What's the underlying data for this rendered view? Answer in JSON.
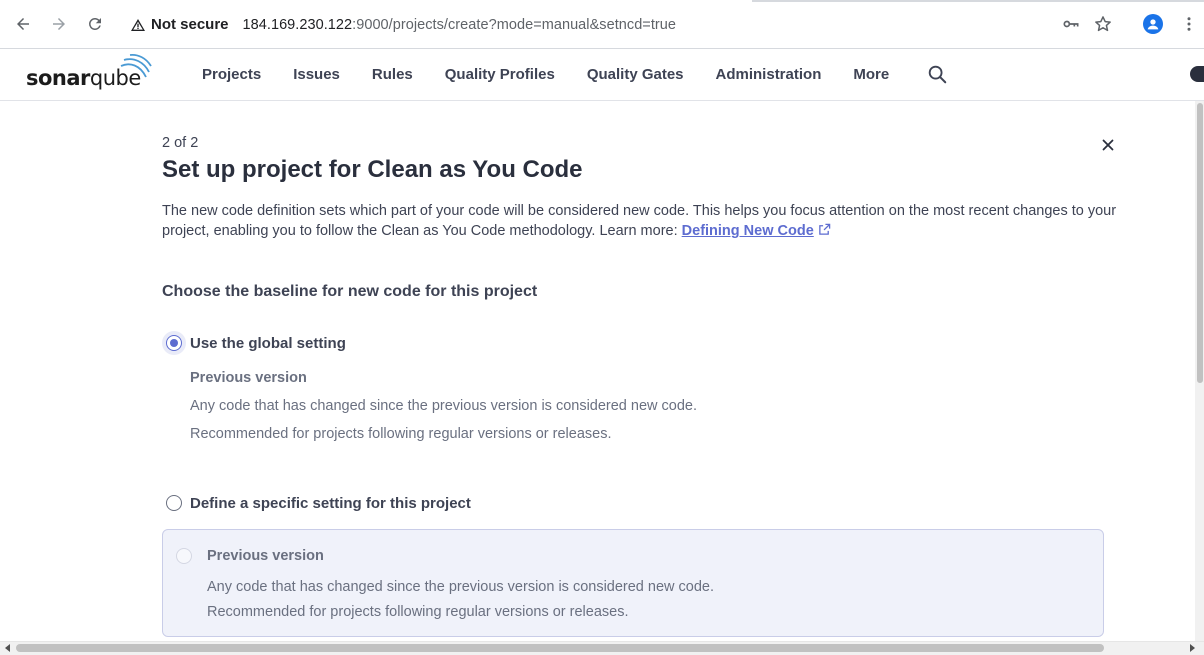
{
  "browser": {
    "security_label": "Not secure",
    "url_host": "184.169.230.122",
    "url_rest": ":9000/projects/create?mode=manual&setncd=true"
  },
  "header": {
    "logo_text_a": "sonar",
    "logo_text_b": "qube",
    "menu": [
      {
        "label": "Projects"
      },
      {
        "label": "Issues"
      },
      {
        "label": "Rules"
      },
      {
        "label": "Quality Profiles"
      },
      {
        "label": "Quality Gates"
      },
      {
        "label": "Administration"
      },
      {
        "label": "More"
      }
    ]
  },
  "page": {
    "step": "2 of 2",
    "title": "Set up project for Clean as You Code",
    "description": "The new code definition sets which part of your code will be considered new code. This helps you focus attention on the most recent changes to your project, enabling you to follow the Clean as You Code methodology. Learn more: ",
    "learn_more_link": "Defining New Code",
    "section_title": "Choose the baseline for new code for this project",
    "global_option": {
      "label": "Use the global setting",
      "selected": true,
      "sub_title": "Previous version",
      "line1": "Any code that has changed since the previous version is considered new code.",
      "line2": "Recommended for projects following regular versions or releases."
    },
    "specific_option": {
      "label": "Define a specific setting for this project",
      "selected": false
    },
    "panel": {
      "title": "Previous version",
      "line1": "Any code that has changed since the previous version is considered new code.",
      "line2": "Recommended for projects following regular versions or releases."
    }
  },
  "colors": {
    "accent": "#5d6cd0",
    "text": "#3e4354",
    "muted": "#6a7080",
    "panel_bg": "#f0f2fa"
  }
}
